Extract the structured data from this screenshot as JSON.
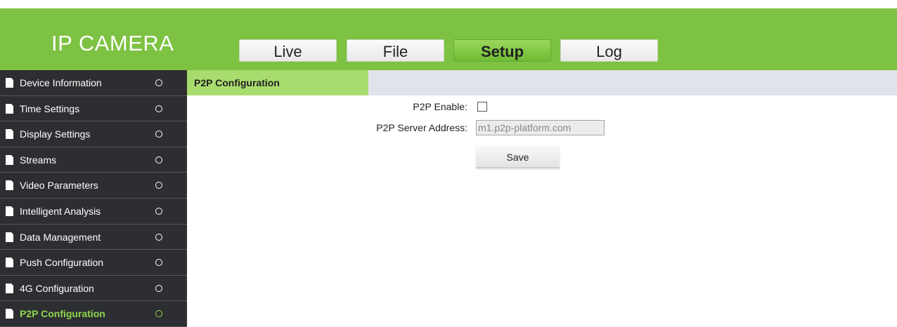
{
  "header": {
    "brand": "IP CAMERA",
    "tabs": [
      {
        "label": "Live",
        "active": false
      },
      {
        "label": "File",
        "active": false
      },
      {
        "label": "Setup",
        "active": true
      },
      {
        "label": "Log",
        "active": false
      }
    ]
  },
  "sidebar": {
    "items": [
      {
        "label": "Device Information",
        "icon": "document-icon",
        "active": false
      },
      {
        "label": "Time Settings",
        "icon": "document-icon",
        "active": false
      },
      {
        "label": "Display Settings",
        "icon": "document-icon",
        "active": false
      },
      {
        "label": "Streams",
        "icon": "document-icon",
        "active": false
      },
      {
        "label": "Video Parameters",
        "icon": "document-icon",
        "active": false
      },
      {
        "label": "Intelligent Analysis",
        "icon": "document-icon",
        "active": false
      },
      {
        "label": "Data Management",
        "icon": "document-icon",
        "active": false
      },
      {
        "label": "Push Configuration",
        "icon": "document-icon",
        "active": false
      },
      {
        "label": "4G Configuration",
        "icon": "document-icon",
        "active": false
      },
      {
        "label": "P2P Configuration",
        "icon": "document-icon",
        "active": true
      }
    ]
  },
  "main": {
    "title": "P2P Configuration",
    "form": {
      "enable_label": "P2P Enable:",
      "enable_checked": false,
      "server_label": "P2P Server Address:",
      "server_value": "m1.p2p-platform.com",
      "save_label": "Save"
    }
  },
  "colors": {
    "header_green": "#7dc242",
    "sidebar_bg": "#2d2e31",
    "active_green": "#8ed84e",
    "title_tab_green": "#a9dc6e"
  }
}
